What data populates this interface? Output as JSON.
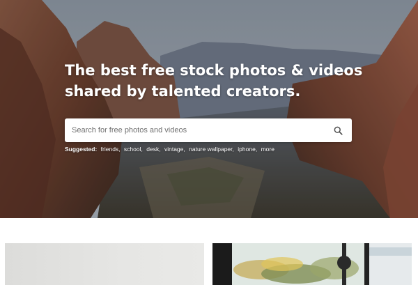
{
  "hero": {
    "headline_line1": "The best free stock photos & videos",
    "headline_line2": "shared by talented creators."
  },
  "search": {
    "placeholder": "Search for free photos and videos",
    "value": "",
    "icon": "search-icon"
  },
  "suggested": {
    "label": "Suggested:",
    "tags": [
      "friends",
      "school",
      "desk",
      "vintage",
      "nature wallpaper",
      "iphone",
      "more"
    ]
  },
  "colors": {
    "headline_text": "#ffffff",
    "search_background": "#ffffff",
    "page_background": "#ffffff"
  }
}
